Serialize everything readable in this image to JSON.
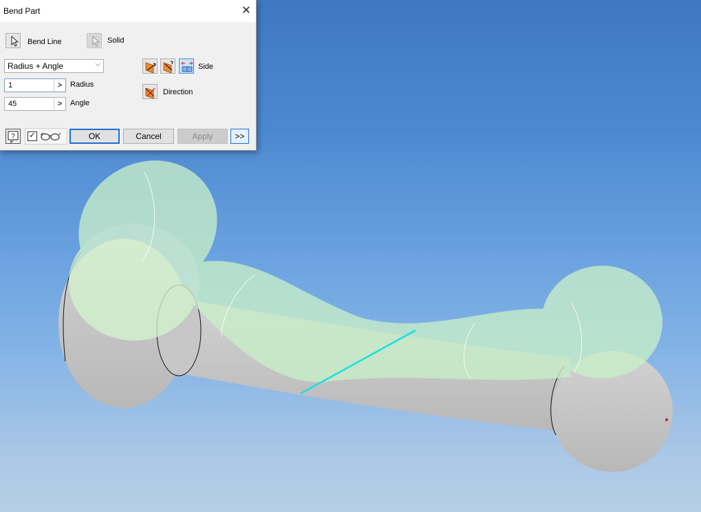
{
  "dialog": {
    "title": "Bend Part",
    "close_glyph": "✕",
    "bend_line_label": "Bend Line",
    "solid_label": "Solid",
    "method_select": {
      "selected": "Radius + Angle",
      "chevron": "⌵"
    },
    "radius": {
      "value": "1",
      "label": "Radius",
      "arrow": ">"
    },
    "angle": {
      "value": "45",
      "label": "Angle",
      "arrow": ">"
    },
    "side_label": "Side",
    "direction_label": "Direction",
    "preview_checkbox": {
      "checked_glyph": "✓"
    },
    "buttons": {
      "ok": "OK",
      "cancel": "Cancel",
      "apply": "Apply",
      "more": ">>"
    }
  },
  "icons": {
    "select_arrow": "cursor-arrow-icon",
    "solid": "solid-select-icon",
    "side_flip": "flip-side-icon",
    "side_bend": "bend-side-icon",
    "side_symmetric": "symmetric-side-icon",
    "direction": "direction-flip-icon",
    "help": "help-icon",
    "glasses": "preview-glasses-icon"
  },
  "colors": {
    "accent_blue": "#1e6fd0",
    "bend_line": "#19e0e0",
    "preview_green": "#c8eec8",
    "solid_gray": "#c9c9c9",
    "icon_orange": "#f08a30"
  }
}
